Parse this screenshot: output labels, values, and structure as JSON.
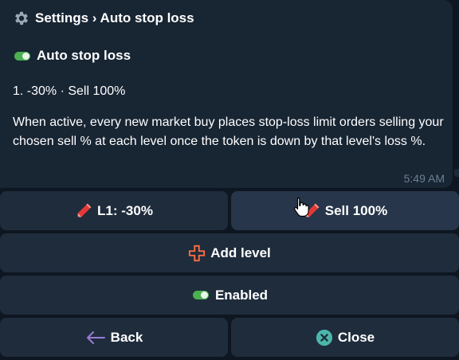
{
  "message": {
    "title": "Settings › Auto stop loss",
    "toggle_label": "Auto stop loss",
    "level_line": "1. -30% · Sell 100%",
    "description": "When active, every new market buy places stop-loss limit orders selling your chosen sell % at each level once the token is down by that level's loss %.",
    "time": "5:49 AM"
  },
  "keyboard": {
    "level_button": "L1: -30%",
    "sell_button": "Sell 100%",
    "add_level": "Add level",
    "enabled": "Enabled",
    "back": "Back",
    "close": "Close"
  },
  "colors": {
    "background": "#0e1621",
    "bubble": "#182533",
    "button": "#1f2c3c",
    "toggle_on": "#4caf50",
    "close_icon": "#4db6ac",
    "back_arrow": "#9b7bd6"
  },
  "icons": {
    "title": "gear-icon",
    "toggle": "toggle-on-icon",
    "edit": "pencil-icon",
    "add": "plus-icon",
    "back": "left-arrow-icon",
    "close": "close-circle-icon"
  }
}
